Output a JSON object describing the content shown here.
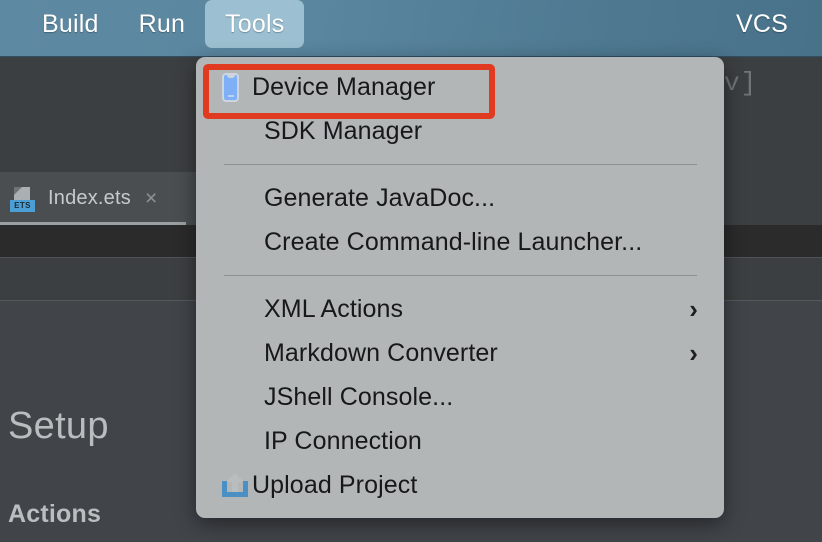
{
  "menubar": {
    "items": [
      {
        "label": "Build",
        "active": false
      },
      {
        "label": "Run",
        "active": false
      },
      {
        "label": "Tools",
        "active": true
      }
    ],
    "right_items": [
      {
        "label": "VCS"
      }
    ]
  },
  "editor": {
    "tab": {
      "filename": "Index.ets",
      "file_type_badge": "ETS",
      "close_label": "×"
    },
    "snippet_text": "v]",
    "setup_heading": "Setup",
    "actions_heading": "Actions"
  },
  "tools_menu": {
    "groups": [
      {
        "items": [
          {
            "label": "Device Manager",
            "icon": "device-phone-icon",
            "arrow": "",
            "highlighted": true
          },
          {
            "label": "SDK Manager",
            "icon": "",
            "arrow": "",
            "highlighted": false
          }
        ]
      },
      {
        "items": [
          {
            "label": "Generate JavaDoc...",
            "icon": "",
            "arrow": "",
            "highlighted": false
          },
          {
            "label": "Create Command-line Launcher...",
            "icon": "",
            "arrow": "",
            "highlighted": false
          }
        ]
      },
      {
        "items": [
          {
            "label": "XML Actions",
            "icon": "",
            "arrow": "›",
            "highlighted": false
          },
          {
            "label": "Markdown Converter",
            "icon": "",
            "arrow": "›",
            "highlighted": false
          },
          {
            "label": "JShell Console...",
            "icon": "",
            "arrow": "",
            "highlighted": false
          },
          {
            "label": "IP Connection",
            "icon": "",
            "arrow": "",
            "highlighted": false
          },
          {
            "label": "Upload Project",
            "icon": "upload-icon",
            "arrow": "",
            "highlighted": false
          }
        ]
      }
    ]
  },
  "colors": {
    "titlebar_blue": "#5a869f",
    "titlebar_active_tab": "#9cc0d1",
    "menu_panel": "#b2b6b6",
    "menu_text": "#16181a",
    "highlight_red": "#e03a20",
    "ide_background": "#3c3f41",
    "accent_blue": "#4b9fd5",
    "device_icon_blue": "#7fb0f7"
  }
}
